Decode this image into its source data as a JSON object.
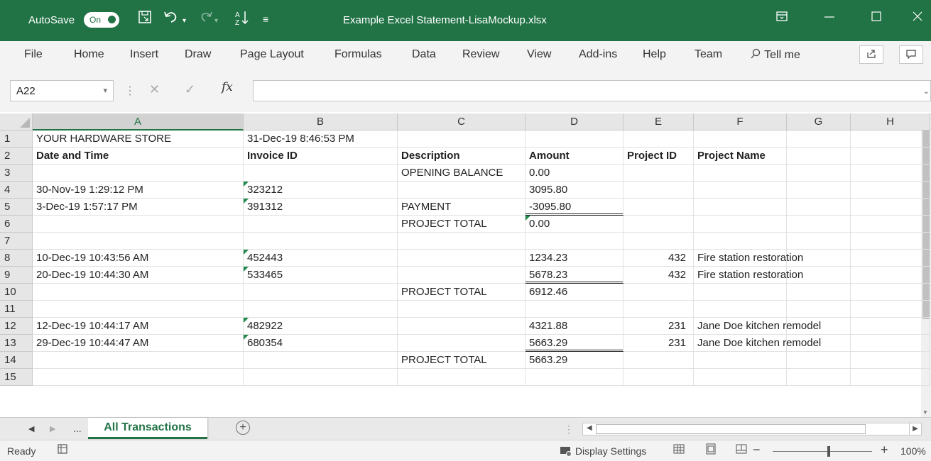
{
  "titlebar": {
    "autosave_label": "AutoSave",
    "toggle_text": "On",
    "filename": "Example Excel Statement-LisaMockup.xlsx",
    "save_icon": "save-icon",
    "undo_icon": "undo-icon",
    "redo_icon": "redo-icon",
    "sort_icon": "sort-ascending-icon",
    "qat_icon": "customize-quick-access-icon",
    "bg_color": "#217346"
  },
  "ribbon": {
    "tabs": [
      "File",
      "Home",
      "Insert",
      "Draw",
      "Page Layout",
      "Formulas",
      "Data",
      "Review",
      "View",
      "Add-ins",
      "Help",
      "Team"
    ],
    "tell_me": "Tell me"
  },
  "formula_bar": {
    "name_box": "A22",
    "fx": "fx",
    "value": ""
  },
  "columns": [
    {
      "label": "A",
      "selected": true
    },
    {
      "label": "B",
      "selected": false
    },
    {
      "label": "C",
      "selected": false
    },
    {
      "label": "D",
      "selected": false
    },
    {
      "label": "E",
      "selected": false
    },
    {
      "label": "F",
      "selected": false
    },
    {
      "label": "G",
      "selected": false
    },
    {
      "label": "H",
      "selected": false
    }
  ],
  "rows": [
    {
      "num": "1",
      "cells": [
        "YOUR HARDWARE STORE",
        "31-Dec-19 8:46:53 PM",
        "",
        "",
        "",
        "",
        "",
        ""
      ]
    },
    {
      "num": "2",
      "bold": true,
      "cells": [
        "Date and Time",
        "Invoice ID",
        "Description",
        "Amount",
        "Project ID",
        "Project Name",
        "",
        ""
      ]
    },
    {
      "num": "3",
      "cells": [
        "",
        "",
        "OPENING BALANCE",
        "0.00",
        "",
        "",
        "",
        ""
      ]
    },
    {
      "num": "4",
      "cells": [
        "30-Nov-19 1:29:12 PM",
        "323212",
        "",
        "3095.80",
        "",
        "",
        "",
        ""
      ]
    },
    {
      "num": "5",
      "cells": [
        "3-Dec-19 1:57:17 PM",
        "391312",
        "PAYMENT",
        "-3095.80",
        "",
        "",
        "",
        ""
      ]
    },
    {
      "num": "6",
      "cells": [
        "",
        "",
        "PROJECT TOTAL",
        "0.00",
        "",
        "",
        "",
        ""
      ]
    },
    {
      "num": "7",
      "cells": [
        "",
        "",
        "",
        "",
        "",
        "",
        "",
        ""
      ]
    },
    {
      "num": "8",
      "cells": [
        "10-Dec-19 10:43:56 AM",
        "452443",
        "",
        "1234.23",
        "432",
        "Fire station restoration",
        "",
        ""
      ]
    },
    {
      "num": "9",
      "cells": [
        "20-Dec-19 10:44:30 AM",
        "533465",
        "",
        "5678.23",
        "432",
        "Fire station restoration",
        "",
        ""
      ]
    },
    {
      "num": "10",
      "cells": [
        "",
        "",
        "PROJECT TOTAL",
        "6912.46",
        "",
        "",
        "",
        ""
      ]
    },
    {
      "num": "11",
      "cells": [
        "",
        "",
        "",
        "",
        "",
        "",
        "",
        ""
      ]
    },
    {
      "num": "12",
      "cells": [
        "12-Dec-19 10:44:17 AM",
        "482922",
        "",
        "4321.88",
        "231",
        "Jane Doe kitchen remodel",
        "",
        ""
      ]
    },
    {
      "num": "13",
      "cells": [
        "29-Dec-19 10:44:47 AM",
        "680354",
        "",
        "5663.29",
        "231",
        "Jane Doe kitchen remodel",
        "",
        ""
      ]
    },
    {
      "num": "14",
      "cells": [
        "",
        "",
        "PROJECT TOTAL",
        "5663.29",
        "",
        "",
        "",
        ""
      ]
    },
    {
      "num": "15",
      "cells": [
        "",
        "",
        "",
        "",
        "",
        "",
        "",
        ""
      ]
    }
  ],
  "text_number_indicators": [
    "B4",
    "B5",
    "B8",
    "B9",
    "B12",
    "B13",
    "D6"
  ],
  "double_underline": [
    "D5",
    "D9",
    "D13"
  ],
  "right_aligned_columns": [
    "E"
  ],
  "sheet_tabs": {
    "overflow": "...",
    "active": "All Transactions"
  },
  "status": {
    "ready": "Ready",
    "display_settings": "Display Settings",
    "zoom_pct": "100%",
    "zoom_level": 1.0
  }
}
